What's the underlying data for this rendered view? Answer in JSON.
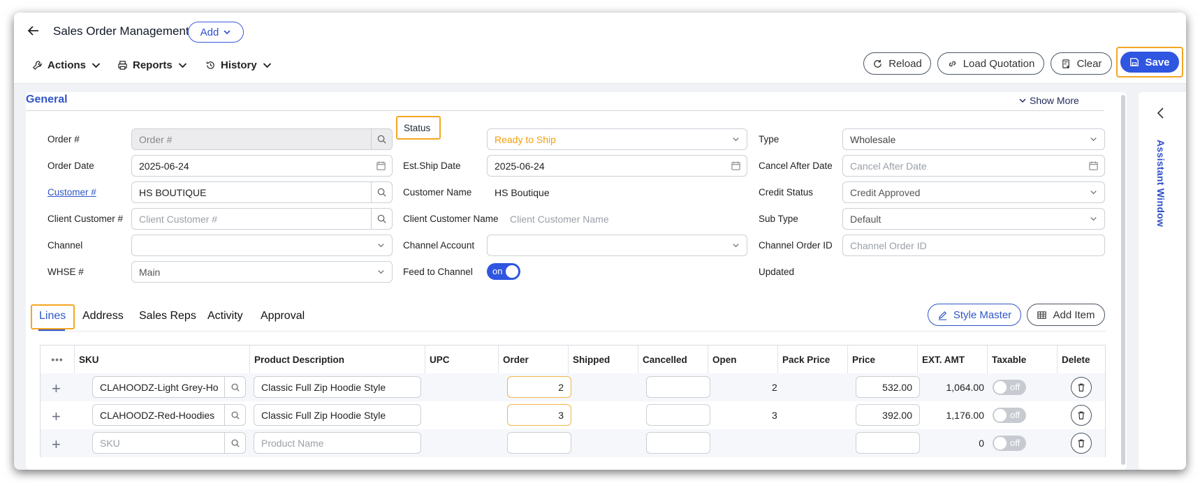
{
  "header": {
    "title": "Sales Order Management",
    "add_label": "Add",
    "menus": [
      "Actions",
      "Reports",
      "History"
    ],
    "buttons": {
      "reload": "Reload",
      "load_quotation": "Load Quotation",
      "clear": "Clear",
      "save": "Save"
    }
  },
  "general": {
    "title": "General",
    "show_more": "Show More",
    "labels": {
      "order_no": "Order #",
      "order_date": "Order Date",
      "customer_no": "Customer #",
      "client_customer_no": "Client Customer #",
      "channel": "Channel",
      "whse": "WHSE #",
      "status": "Status",
      "est_ship_date": "Est.Ship Date",
      "customer_name": "Customer Name",
      "client_customer_name": "Client Customer Name",
      "channel_account": "Channel Account",
      "feed_to_channel": "Feed to Channel",
      "type": "Type",
      "cancel_after_date": "Cancel After Date",
      "credit_status": "Credit Status",
      "sub_type": "Sub Type",
      "channel_order_id": "Channel Order ID",
      "updated": "Updated"
    },
    "values": {
      "order_no_placeholder": "Order #",
      "order_date": "2025-06-24",
      "customer_no": "HS BOUTIQUE",
      "client_customer_no_placeholder": "Client Customer #",
      "channel": "",
      "whse": "Main",
      "status": "Ready to Ship",
      "est_ship_date": "2025-06-24",
      "customer_name": "HS Boutique",
      "client_customer_name_placeholder": "Client Customer Name",
      "channel_account": "",
      "feed_to_channel": "on",
      "type": "Wholesale",
      "cancel_after_date_placeholder": "Cancel After Date",
      "credit_status": "Credit Approved",
      "sub_type": "Default",
      "channel_order_id_placeholder": "Channel Order ID"
    }
  },
  "tabs": [
    "Lines",
    "Address",
    "Sales Reps",
    "Activity",
    "Approval"
  ],
  "tab_actions": {
    "style_master": "Style Master",
    "add_item": "Add Item"
  },
  "table": {
    "columns": [
      "SKU",
      "Product Description",
      "UPC",
      "Order",
      "Shipped",
      "Cancelled",
      "Open",
      "Pack Price",
      "Price",
      "EXT. AMT",
      "Taxable",
      "Delete"
    ],
    "rows": [
      {
        "sku": "CLAHOODZ-Light Grey-Ho",
        "description": "Classic Full Zip Hoodie Style",
        "order": "2",
        "open": "2",
        "price": "532.00",
        "ext_amt": "1,064.00",
        "taxable": "off"
      },
      {
        "sku": "CLAHOODZ-Red-Hoodies",
        "description": "Classic Full Zip Hoodie Style",
        "order": "3",
        "open": "3",
        "price": "392.00",
        "ext_amt": "1,176.00",
        "taxable": "off"
      }
    ],
    "new_row": {
      "sku_placeholder": "SKU",
      "description_placeholder": "Product Name",
      "ext_amt": "0",
      "taxable": "off"
    }
  },
  "assistant": {
    "label": "Assistant Window"
  },
  "colors": {
    "accent": "#2f56e0",
    "highlight": "#f5a623",
    "status_orange": "#f59e0b"
  }
}
